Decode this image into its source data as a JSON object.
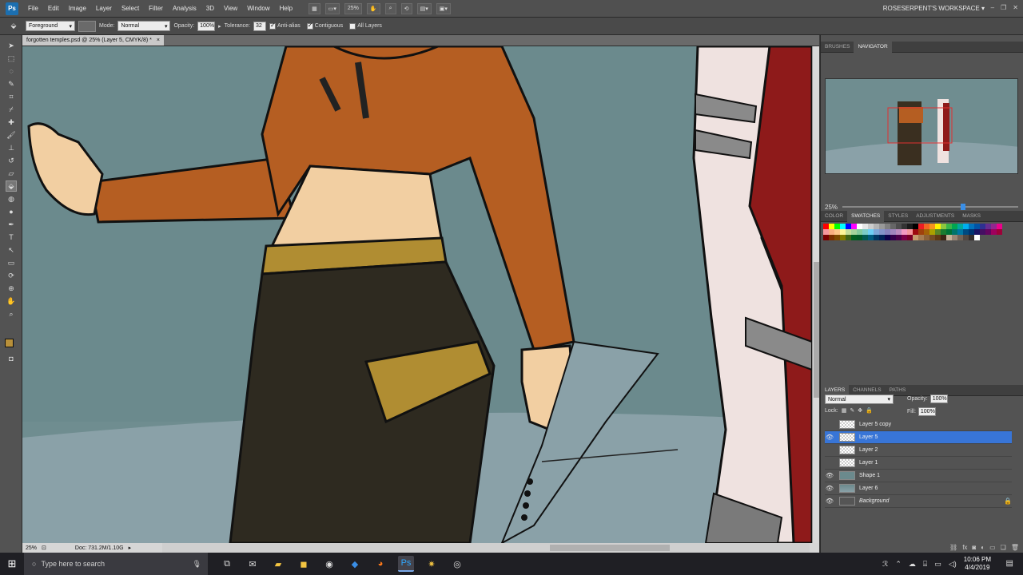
{
  "menubar": {
    "logo": "Ps",
    "items": [
      "File",
      "Edit",
      "Image",
      "Layer",
      "Select",
      "Filter",
      "Analysis",
      "3D",
      "View",
      "Window",
      "Help"
    ],
    "zoom": "25%",
    "workspace": "ROSESERPENT'S WORKSPACE"
  },
  "options": {
    "preset": "Foreground",
    "mode_label": "Mode:",
    "mode": "Normal",
    "opacity_label": "Opacity:",
    "opacity": "100%",
    "tolerance_label": "Tolerance:",
    "tolerance": "32",
    "anti_alias": "Anti-alias",
    "contiguous": "Contiguous",
    "all_layers": "All Layers"
  },
  "document": {
    "tab": "forgotten temples.psd @ 25% (Layer 5, CMYK/8) *",
    "close": "×"
  },
  "status": {
    "zoom": "25%",
    "doc": "Doc: 731.2M/1.10G"
  },
  "panels": {
    "top_tabs": [
      "BRUSHES",
      "NAVIGATOR"
    ],
    "nav_zoom": "25%",
    "mid_tabs": [
      "COLOR",
      "SWATCHES",
      "STYLES",
      "ADJUSTMENTS",
      "MASKS"
    ],
    "swatch_colors": [
      "#ff0000",
      "#ffff00",
      "#00ff00",
      "#00ffff",
      "#0000ff",
      "#ff00ff",
      "#ffffff",
      "#e6e6e6",
      "#cccccc",
      "#b3b3b3",
      "#999999",
      "#808080",
      "#666666",
      "#4d4d4d",
      "#333333",
      "#1a1a1a",
      "#000000",
      "#ed1c24",
      "#f26522",
      "#f7941d",
      "#fff200",
      "#8dc63f",
      "#39b54a",
      "#00a651",
      "#00a99d",
      "#00aeef",
      "#0072bc",
      "#0054a6",
      "#2e3192",
      "#662d91",
      "#92278f",
      "#ec008c",
      "#f6989d",
      "#f9ad81",
      "#fdc68a",
      "#fff799",
      "#c4df9b",
      "#a3d39c",
      "#82ca9d",
      "#7accc8",
      "#6dcff6",
      "#7da7d9",
      "#8393ca",
      "#8781bd",
      "#a186be",
      "#bd8cbf",
      "#f49ac1",
      "#f5989d",
      "#9e0b0f",
      "#a0410d",
      "#a36209",
      "#aba000",
      "#598527",
      "#1a7b30",
      "#007236",
      "#00746b",
      "#0076a3",
      "#004a80",
      "#003471",
      "#1b1464",
      "#440e62",
      "#630460",
      "#9e005d",
      "#9e0039",
      "#790000",
      "#7b2e00",
      "#7d4900",
      "#827b00",
      "#406618",
      "#005e20",
      "#005826",
      "#005952",
      "#005b7f",
      "#003663",
      "#002157",
      "#0d004c",
      "#32004b",
      "#4b0049",
      "#7b0046",
      "#7a0026",
      "#c69c6d",
      "#a67c52",
      "#8c6239",
      "#754c24",
      "#603913",
      "#3c2415",
      "#c7b299",
      "#998675",
      "#736357",
      "#534741",
      "#362f2d",
      "#ffffff"
    ],
    "layers_tabs": [
      "LAYERS",
      "CHANNELS",
      "PATHS"
    ],
    "blend": "Normal",
    "opacity_label": "Opacity:",
    "opacity": "100%",
    "lock_label": "Lock:",
    "fill_label": "Fill:",
    "fill": "100%",
    "layers": [
      {
        "name": "Layer 5 copy",
        "visible": false,
        "selected": false,
        "italic": false
      },
      {
        "name": "Layer 5",
        "visible": true,
        "selected": true,
        "italic": false
      },
      {
        "name": "Layer 2",
        "visible": false,
        "selected": false,
        "italic": false
      },
      {
        "name": "Layer 1",
        "visible": false,
        "selected": false,
        "italic": false
      },
      {
        "name": "Shape 1",
        "visible": true,
        "selected": false,
        "italic": false
      },
      {
        "name": "Layer 6",
        "visible": true,
        "selected": false,
        "italic": false
      },
      {
        "name": "Background",
        "visible": true,
        "selected": false,
        "italic": true
      }
    ]
  },
  "taskbar": {
    "search_placeholder": "Type here to search",
    "time": "10:06 PM",
    "date": "4/4/2019"
  }
}
